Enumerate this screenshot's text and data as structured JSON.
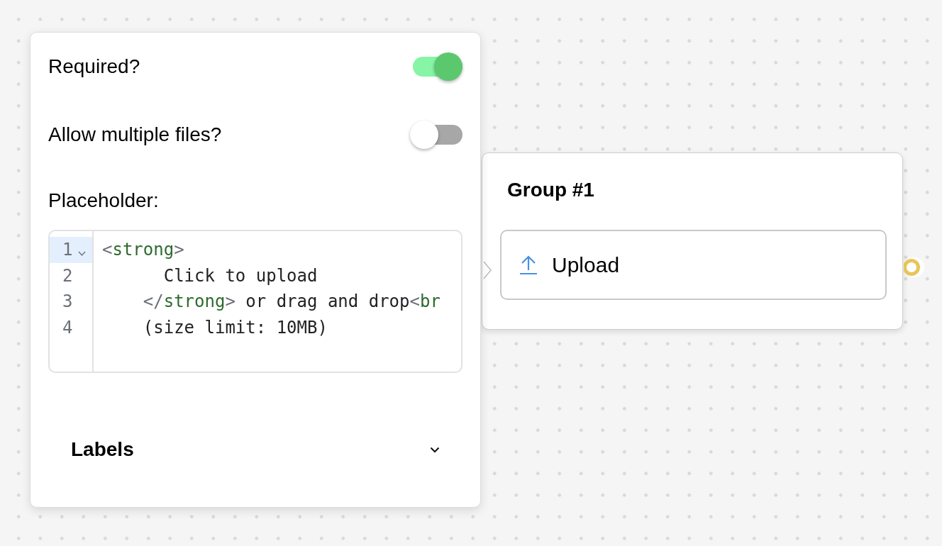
{
  "settings": {
    "toggles": [
      {
        "label": "Required?",
        "on": true
      },
      {
        "label": "Allow multiple files?",
        "on": false
      }
    ],
    "placeholder": {
      "label": "Placeholder:",
      "lines": [
        {
          "number": "1",
          "active": true,
          "foldable": true,
          "tokens": [
            {
              "kind": "punct",
              "text": "<"
            },
            {
              "kind": "tag",
              "text": "strong"
            },
            {
              "kind": "punct",
              "text": ">"
            }
          ]
        },
        {
          "number": "2",
          "active": false,
          "foldable": false,
          "tokens": [
            {
              "kind": "text",
              "text": "      Click to upload"
            }
          ]
        },
        {
          "number": "3",
          "active": false,
          "foldable": false,
          "tokens": [
            {
              "kind": "punct",
              "text": "    </"
            },
            {
              "kind": "tag",
              "text": "strong"
            },
            {
              "kind": "punct",
              "text": ">"
            },
            {
              "kind": "text",
              "text": " or drag and drop"
            },
            {
              "kind": "punct",
              "text": "<"
            },
            {
              "kind": "tag",
              "text": "br"
            }
          ]
        },
        {
          "number": "4",
          "active": false,
          "foldable": false,
          "tokens": [
            {
              "kind": "text",
              "text": "    (size limit: 10MB)"
            }
          ]
        }
      ]
    },
    "labels": {
      "title": "Labels",
      "expanded": false
    }
  },
  "group": {
    "title": "Group #1",
    "items": [
      {
        "label": "Upload"
      }
    ]
  }
}
